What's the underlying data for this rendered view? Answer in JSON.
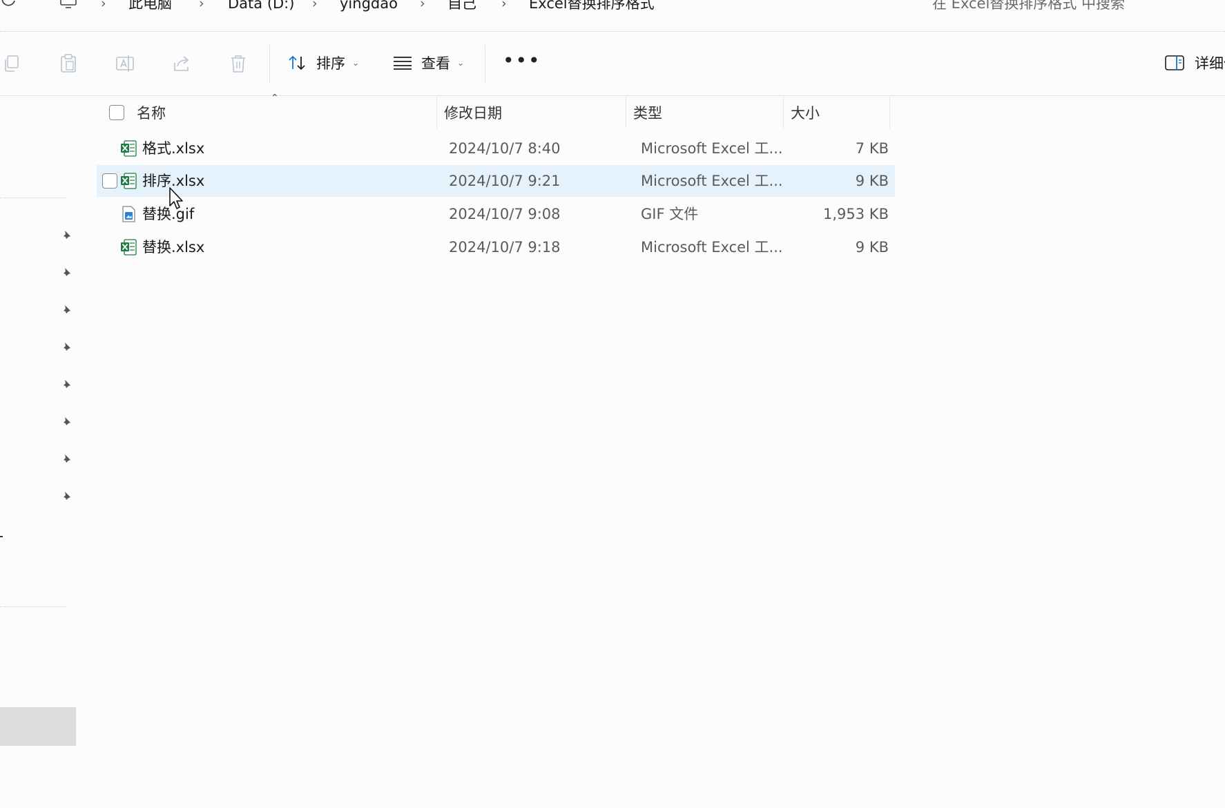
{
  "address": {
    "crumbs": [
      "此电脑",
      "Data (D:)",
      "yingdao",
      "自己",
      "Excel替换排序格式"
    ],
    "search_placeholder": "在 Excel替换排序格式 中搜索"
  },
  "toolbar": {
    "icons": [
      "copy-icon",
      "paste-icon",
      "rename-icon",
      "share-icon",
      "delete-icon"
    ],
    "sort_label": "排序",
    "view_label": "查看",
    "more_label": "•••",
    "details_label": "详细信息"
  },
  "columns": {
    "name": "名称",
    "date": "修改日期",
    "type": "类型",
    "size": "大小"
  },
  "files": [
    {
      "name": "格式.xlsx",
      "date": "2024/10/7 8:40",
      "type": "Microsoft Excel 工...",
      "size": "7 KB",
      "icon": "excel-file-icon"
    },
    {
      "name": "排序.xlsx",
      "date": "2024/10/7 9:21",
      "type": "Microsoft Excel 工...",
      "size": "9 KB",
      "icon": "excel-file-icon"
    },
    {
      "name": "替换.gif",
      "date": "2024/10/7 9:08",
      "type": "GIF 文件",
      "size": "1,953 KB",
      "icon": "gif-file-icon"
    },
    {
      "name": "替换.xlsx",
      "date": "2024/10/7 9:18",
      "type": "Microsoft Excel 工...",
      "size": "9 KB",
      "icon": "excel-file-icon"
    }
  ],
  "colors": {
    "selection": "#e5f1fb",
    "accent": "#1a73c8",
    "excel_green": "#1d7b43"
  }
}
